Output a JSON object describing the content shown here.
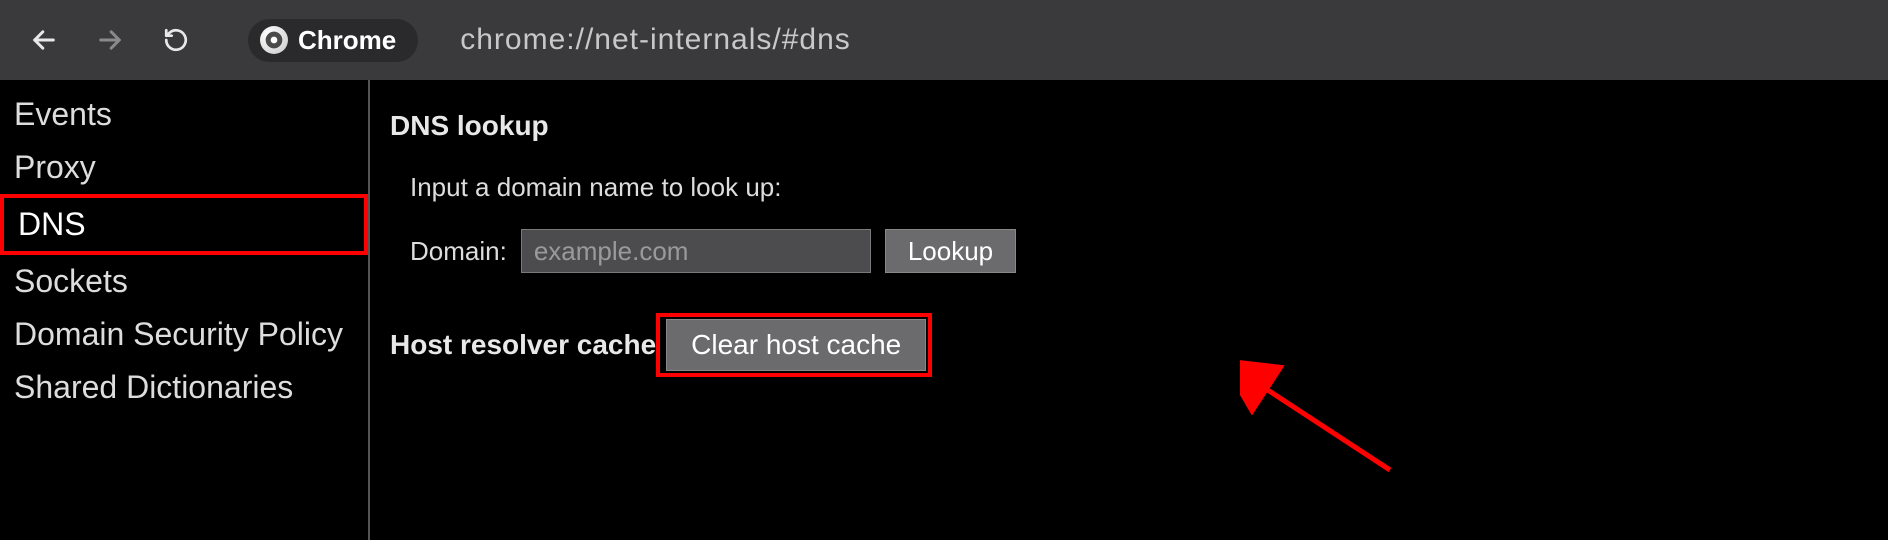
{
  "address_bar": {
    "app_label": "Chrome",
    "url": "chrome://net-internals/#dns"
  },
  "sidebar": {
    "items": [
      {
        "label": "Events"
      },
      {
        "label": "Proxy"
      },
      {
        "label": "DNS"
      },
      {
        "label": "Sockets"
      },
      {
        "label": "Domain Security Policy"
      },
      {
        "label": "Shared Dictionaries"
      }
    ],
    "selected_index": 2
  },
  "main": {
    "section1_title": "DNS lookup",
    "prompt": "Input a domain name to look up:",
    "domain_label": "Domain:",
    "domain_placeholder": "example.com",
    "domain_value": "",
    "lookup_label": "Lookup",
    "section2_title": "Host resolver cache",
    "clear_label": "Clear host cache"
  },
  "annotation": {
    "highlight_sidebar": "DNS",
    "highlight_button": "Clear host cache",
    "arrow_target": "Clear host cache",
    "color": "#ff0000"
  }
}
